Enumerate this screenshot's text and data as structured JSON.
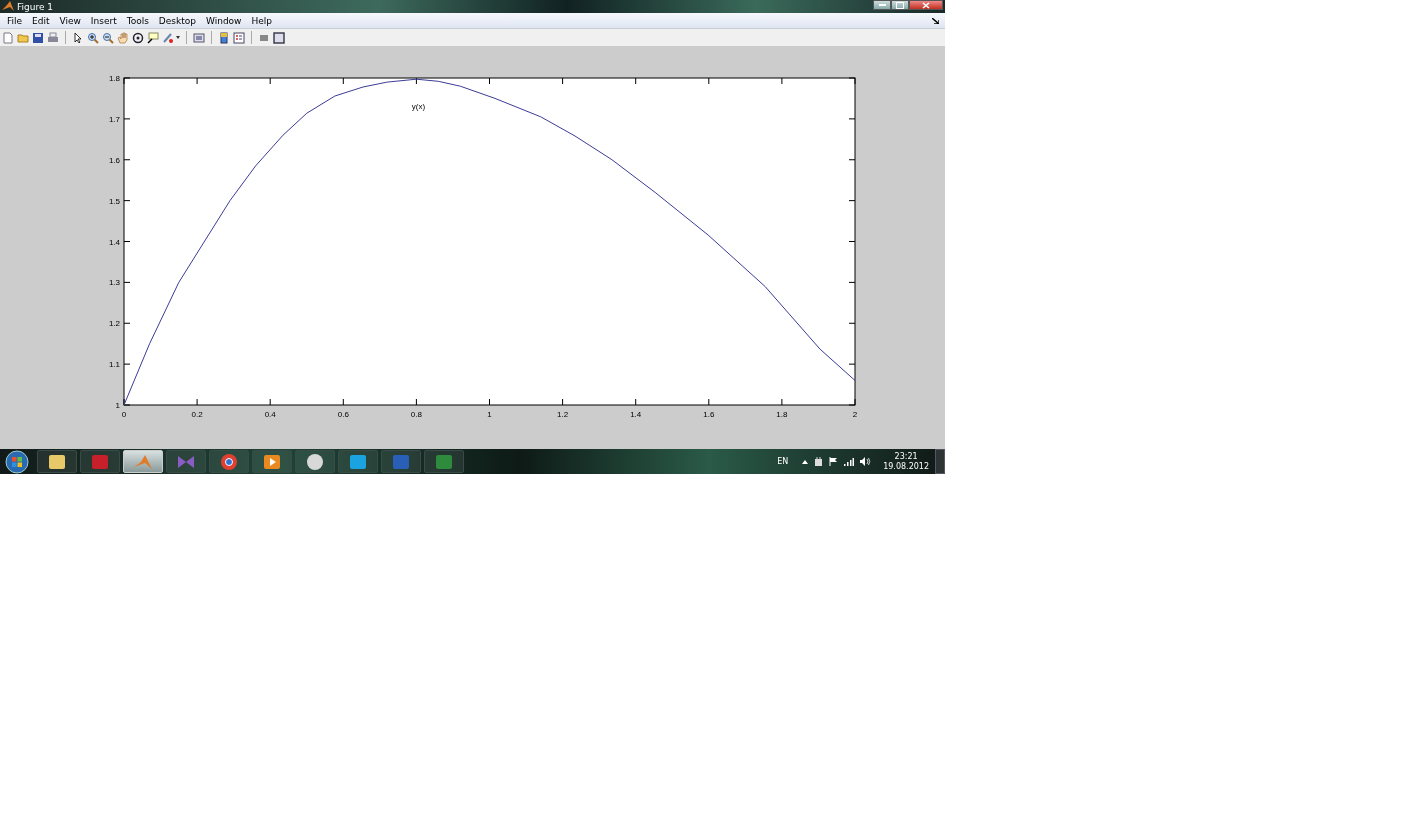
{
  "window": {
    "title": "Figure 1"
  },
  "menu": [
    "File",
    "Edit",
    "View",
    "Insert",
    "Tools",
    "Desktop",
    "Window",
    "Help"
  ],
  "figure": {
    "chart_data": {
      "type": "line",
      "x": [
        0,
        0.07,
        0.15,
        0.29,
        0.36,
        0.435,
        0.5,
        0.577,
        0.654,
        0.72,
        0.8,
        0.86,
        0.92,
        1.015,
        1.14,
        1.234,
        1.335,
        1.453,
        1.598,
        1.754,
        1.904,
        2
      ],
      "series": [
        {
          "name": "y(x)",
          "color": "#3c3c96",
          "values": [
            1.0,
            1.15,
            1.3,
            1.5,
            1.585,
            1.66,
            1.714,
            1.756,
            1.778,
            1.79,
            1.797,
            1.792,
            1.78,
            1.75,
            1.705,
            1.658,
            1.6,
            1.52,
            1.416,
            1.29,
            1.137,
            1.06
          ]
        }
      ],
      "xlim": [
        0,
        2
      ],
      "ylim": [
        1,
        1.8
      ],
      "xticks": [
        0,
        0.2,
        0.4,
        0.6,
        0.8,
        1,
        1.2,
        1.4,
        1.6,
        1.8,
        2
      ],
      "yticks": [
        1,
        1.1,
        1.2,
        1.3,
        1.4,
        1.5,
        1.6,
        1.7,
        1.8
      ]
    }
  },
  "taskbar": {
    "buttons": [
      {
        "kind": "folder",
        "selected": false
      },
      {
        "kind": "acrobat",
        "selected": false
      },
      {
        "kind": "matlab",
        "selected": true
      },
      {
        "kind": "studio",
        "selected": false
      },
      {
        "kind": "chrome",
        "selected": false
      },
      {
        "kind": "media",
        "selected": false
      },
      {
        "kind": "disc",
        "selected": false
      },
      {
        "kind": "skype",
        "selected": false
      },
      {
        "kind": "word",
        "selected": false
      },
      {
        "kind": "excel",
        "selected": false
      }
    ],
    "language": "EN",
    "time": "23:21",
    "date": "19.08.2012"
  }
}
